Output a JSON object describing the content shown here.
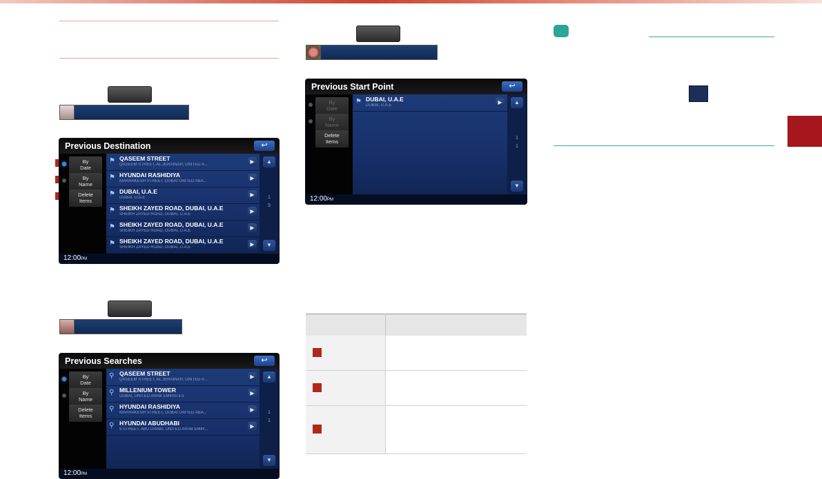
{
  "screens": {
    "destination": {
      "title": "Previous  Destination",
      "back_icon": "back-arrow-icon",
      "side_buttons": [
        {
          "line1": "By",
          "line2": "Date"
        },
        {
          "line1": "By",
          "line2": "Name"
        },
        {
          "line1": "Delete",
          "line2": "Items"
        }
      ],
      "rows": [
        {
          "main": "QASEEM STREET",
          "sub": "QASEEM STREET, AL JERAINAH, UNITED A..."
        },
        {
          "main": "HYUNDAI RASHIDIYA",
          "sub": "MARRAKESH STREET, DUBAI UNITED ABA..."
        },
        {
          "main": "DUBAI, U.A.E",
          "sub": "DUBAI, U.A.E"
        },
        {
          "main": "SHEIKH ZAYED ROAD, DUBAI, U.A.E",
          "sub": "SHEIKH ZAYED ROAD, DUBAI, U.A.E"
        },
        {
          "main": "SHEIKH ZAYED ROAD, DUBAI, U.A.E",
          "sub": "SHEIKH ZAYED ROAD, DUBAI, U.A.E"
        },
        {
          "main": "SHEIKH ZAYED ROAD, DUBAI, U.A.E",
          "sub": "SHEIKH ZAYED ROAD, DUBAI, U.A.E"
        }
      ],
      "page_current": "1",
      "page_total": "9",
      "clock": "12:00",
      "clock_suffix": "PM"
    },
    "searches": {
      "title": "Previous Searches",
      "side_buttons": [
        {
          "line1": "By",
          "line2": "Date"
        },
        {
          "line1": "By",
          "line2": "Name"
        },
        {
          "line1": "Delete",
          "line2": "Items"
        }
      ],
      "rows": [
        {
          "main": "QASEEM STREET",
          "sub": "QASEEM STREET, AL JERAINAH, UNITED A..."
        },
        {
          "main": "MILLENIUM TOWER",
          "sub": "DUBAI, UNITED ARAB EMIRATES"
        },
        {
          "main": "HYUNDAI RASHIDIYA",
          "sub": "MARRAKESH STREET, DUBAI UNITED ABA..."
        },
        {
          "main": "HYUNDAI ABUDHABI",
          "sub": "9 STREET, ABU DHABI, UNITED ARAB EMIR..."
        }
      ],
      "page_current": "1",
      "page_total": "1",
      "clock": "12:00",
      "clock_suffix": "PM"
    },
    "start_point": {
      "title": "Previous Start Point",
      "side_buttons": [
        {
          "line1": "By",
          "line2": "Date"
        },
        {
          "line1": "By",
          "line2": "Name"
        },
        {
          "line1": "Delete",
          "line2": "Items"
        }
      ],
      "rows": [
        {
          "main": "DUBAI, U.A.E",
          "sub": "DUBAI, U.A.E"
        }
      ],
      "page_current": "1",
      "page_total": "1",
      "clock": "12:00",
      "clock_suffix": "PM"
    }
  },
  "colors": {
    "accent_red": "#b0271d",
    "accent_teal": "#2aa596",
    "navy": "#1c2f57"
  }
}
